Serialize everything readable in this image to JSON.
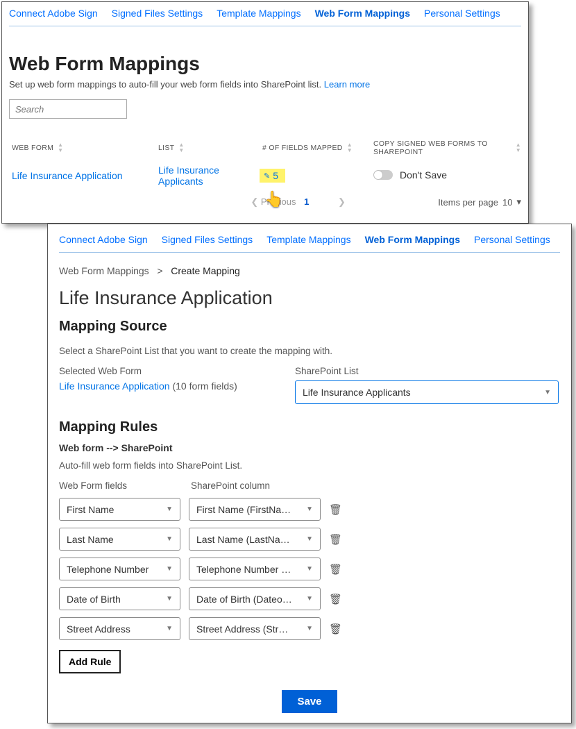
{
  "tabs": {
    "connect": "Connect Adobe Sign",
    "signed": "Signed Files Settings",
    "template": "Template Mappings",
    "webform": "Web Form Mappings",
    "personal": "Personal Settings"
  },
  "page1": {
    "title": "Web Form Mappings",
    "subtitle_pre": "Set up web form mappings to auto-fill your web form fields into SharePoint list. ",
    "learn_more": "Learn more",
    "search_placeholder": "Search",
    "columns": {
      "webform": "WEB FORM",
      "list": "LIST",
      "count": "# OF FIELDS MAPPED",
      "copy": "COPY SIGNED WEB FORMS TO SHAREPOINT"
    },
    "row": {
      "webform": "Life Insurance Application",
      "list": "Life Insurance Applicants",
      "count": "5",
      "dont_save": "Don't Save"
    },
    "pager": {
      "prev": "Previous",
      "page": "1",
      "ipp_label": "Items per page",
      "ipp_value": "10"
    }
  },
  "page2": {
    "breadcrumb": {
      "root": "Web Form Mappings",
      "sep": ">",
      "current": "Create Mapping"
    },
    "form_title": "Life Insurance Application",
    "mapping_source": {
      "heading": "Mapping Source",
      "desc": "Select a SharePoint List that you want to create the mapping with.",
      "selected_label": "Selected Web Form",
      "selected_link": "Life Insurance Application",
      "selected_suffix": " (10 form fields)",
      "splist_label": "SharePoint List",
      "splist_value": "Life Insurance Applicants"
    },
    "mapping_rules": {
      "heading": "Mapping Rules",
      "subhead": "Web form --> SharePoint",
      "desc": "Auto-fill web form fields into SharePoint List.",
      "col1": "Web Form fields",
      "col2": "SharePoint column",
      "rows": [
        {
          "wf": "First Name",
          "sp": "First Name (FirstName)"
        },
        {
          "wf": "Last Name",
          "sp": "Last Name (LastName)"
        },
        {
          "wf": "Telephone Number",
          "sp": "Telephone Number (Tele…"
        },
        {
          "wf": "Date of Birth",
          "sp": "Date of Birth (DateofBirth)"
        },
        {
          "wf": "Street Address",
          "sp": "Street Address (StreetAd…"
        }
      ],
      "add_rule": "Add Rule"
    },
    "save": "Save"
  }
}
